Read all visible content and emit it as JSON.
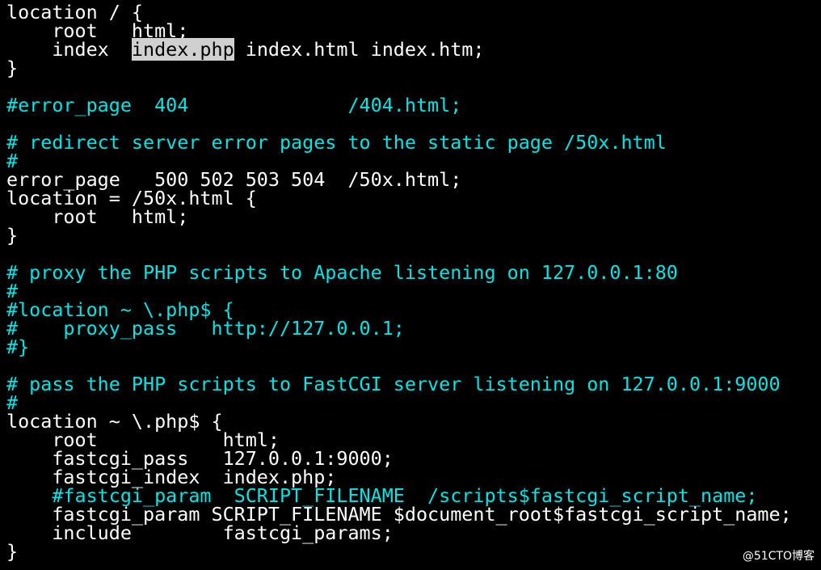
{
  "colors": {
    "background": "#000000",
    "text": "#ffffff",
    "comment": "#00e5e5",
    "highlight_bg": "#d0d0d0",
    "highlight_fg": "#000000"
  },
  "lines": [
    {
      "text": "location / {"
    },
    {
      "text": "    root   html;"
    },
    {
      "pre": "    index  ",
      "hl": "index.php",
      "post": " index.html index.htm;"
    },
    {
      "text": "}"
    },
    {
      "text": ""
    },
    {
      "text": "#error_page  404              /404.html;",
      "comment": true
    },
    {
      "text": ""
    },
    {
      "text": "# redirect server error pages to the static page /50x.html",
      "comment": true
    },
    {
      "text": "#",
      "comment": true
    },
    {
      "text": "error_page   500 502 503 504  /50x.html;"
    },
    {
      "text": "location = /50x.html {"
    },
    {
      "text": "    root   html;"
    },
    {
      "text": "}"
    },
    {
      "text": ""
    },
    {
      "text": "# proxy the PHP scripts to Apache listening on 127.0.0.1:80",
      "comment": true
    },
    {
      "text": "#",
      "comment": true
    },
    {
      "text": "#location ~ \\.php$ {",
      "comment": true
    },
    {
      "text": "#    proxy_pass   http://127.0.0.1;",
      "comment": true
    },
    {
      "text": "#}",
      "comment": true
    },
    {
      "text": ""
    },
    {
      "text": "# pass the PHP scripts to FastCGI server listening on 127.0.0.1:9000",
      "comment": true
    },
    {
      "text": "#",
      "comment": true
    },
    {
      "text": "location ~ \\.php$ {"
    },
    {
      "text": "    root           html;"
    },
    {
      "text": "    fastcgi_pass   127.0.0.1:9000;"
    },
    {
      "text": "    fastcgi_index  index.php;"
    },
    {
      "text": "    #fastcgi_param  SCRIPT_FILENAME  /scripts$fastcgi_script_name;",
      "comment": true
    },
    {
      "text": "    fastcgi_param SCRIPT_FILENAME $document_root$fastcgi_script_name;"
    },
    {
      "text": "    include        fastcgi_params;"
    },
    {
      "text": "}"
    }
  ],
  "watermark": "@51CTO博客"
}
